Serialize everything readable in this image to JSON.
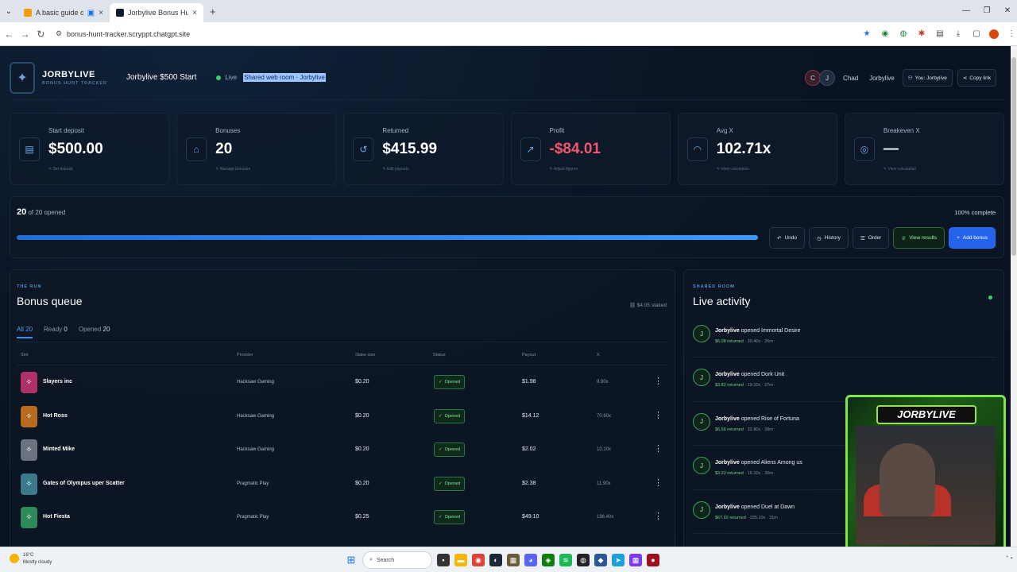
{
  "browser": {
    "tabs": [
      {
        "title": "A basic guide on how to pl",
        "active": false
      },
      {
        "title": "Jorbylive Bonus Hunt Tracker",
        "active": true
      }
    ],
    "url": "bonus-hunt-tracker.scryppt.chatgpt.site"
  },
  "header": {
    "brand_name": "JORBYLIVE",
    "brand_sub": "BONUS HUNT TRACKER",
    "hunt_title": "Jorbylive $500 Start",
    "live_label": "Live",
    "room_label": "Shared web room · Jorbylive",
    "avatar_c": "C",
    "avatar_j": "J",
    "user1": "Chad",
    "user2": "Jorbylive",
    "you_button": "You: Jorbylive",
    "copy_button": "Copy link"
  },
  "stats": [
    {
      "label": "Start deposit",
      "value": "$500.00",
      "action": "Set deposit",
      "icon": "wallet-icon"
    },
    {
      "label": "Bonuses",
      "value": "20",
      "action": "Manage bonuses",
      "icon": "gift-icon"
    },
    {
      "label": "Returned",
      "value": "$415.99",
      "action": "Edit payouts",
      "icon": "refresh-icon"
    },
    {
      "label": "Profit",
      "value": "-$84.01",
      "action": "Adjust figures",
      "icon": "trend-icon"
    },
    {
      "label": "Avg X",
      "value": "102.71x",
      "action": "View calculation",
      "icon": "gauge-icon"
    },
    {
      "label": "Breakeven X",
      "value": "—",
      "action": "View calculation",
      "icon": "target-icon"
    }
  ],
  "progress": {
    "opened": "20",
    "of_text": "of 20 opened",
    "percent_text": "100% complete",
    "fraction": 1.0,
    "buttons": {
      "undo": "Undo",
      "history": "History",
      "order": "Order",
      "results": "View results",
      "add": "Add bonus"
    }
  },
  "queue": {
    "eyebrow": "THE RUN",
    "title": "Bonus queue",
    "staked": "$4.05 staked",
    "filters": [
      {
        "label": "All",
        "count": "20"
      },
      {
        "label": "Ready",
        "count": "0"
      },
      {
        "label": "Opened",
        "count": "20"
      }
    ],
    "columns": [
      "Slot",
      "Provider",
      "Stake size",
      "Status",
      "Payout",
      "X"
    ],
    "rows": [
      {
        "slot": "Slayers inc",
        "provider": "Hacksaw Gaming",
        "stake": "$0.20",
        "status": "Opened",
        "payout": "$1.98",
        "x": "9.90x",
        "color": "#b0306a"
      },
      {
        "slot": "Hot Ross",
        "provider": "Hacksaw Gaming",
        "stake": "$0.20",
        "status": "Opened",
        "payout": "$14.12",
        "x": "70.60x",
        "color": "#b86a1e"
      },
      {
        "slot": "Minted Mike",
        "provider": "Hacksaw Gaming",
        "stake": "$0.20",
        "status": "Opened",
        "payout": "$2.02",
        "x": "10.10x",
        "color": "#6b7280"
      },
      {
        "slot": "Gates of Olympus uper Scatter",
        "provider": "Pragmatic Play",
        "stake": "$0.20",
        "status": "Opened",
        "payout": "$2.38",
        "x": "11.90x",
        "color": "#3b7a8a"
      },
      {
        "slot": "Hot Fiesta",
        "provider": "Pragmatic Play",
        "stake": "$0.25",
        "status": "Opened",
        "payout": "$49.10",
        "x": "196.40x",
        "color": "#2f8a5a"
      }
    ]
  },
  "activity": {
    "eyebrow": "SHARED ROOM",
    "title": "Live activity",
    "items": [
      {
        "user": "Jorbylive",
        "text": "opened Immortal Desire",
        "returned": "$6.08 returned",
        "meta": "· 30.40x · 26m"
      },
      {
        "user": "Jorbylive",
        "text": "opened Dork Unit",
        "returned": "$3.82 returned",
        "meta": "· 19.10x · 27m"
      },
      {
        "user": "Jorbylive",
        "text": "opened Rise of Fortuna",
        "returned": "$6.56 returned",
        "meta": "· 32.80x · 28m"
      },
      {
        "user": "Jorbylive",
        "text": "opened Aliens Among us",
        "returned": "$3.22 returned",
        "meta": "· 16.10x · 30m"
      },
      {
        "user": "Jorbylive",
        "text": "opened Duel at Dawn",
        "returned": "$67.02 returned",
        "meta": "· 335.10x · 31m"
      }
    ]
  },
  "webcam": {
    "banner": "JORBYLIVE"
  },
  "taskbar": {
    "temp": "16°C",
    "weather": "Mostly cloudy",
    "search": "Search"
  }
}
